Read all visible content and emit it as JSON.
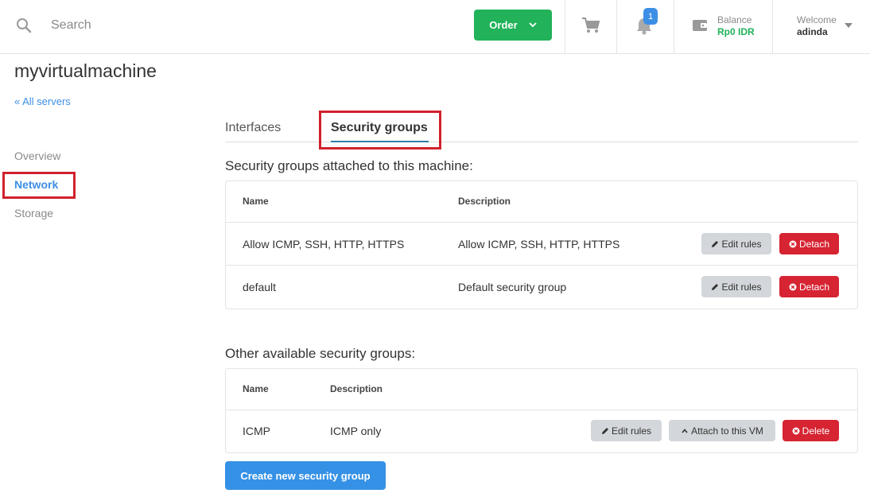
{
  "header": {
    "search_placeholder": "Search",
    "order_label": "Order",
    "notification_count": "1",
    "balance_label": "Balance",
    "balance_value": "Rp0 IDR",
    "welcome_label": "Welcome",
    "user_name": "adinda"
  },
  "page": {
    "title": "myvirtualmachine",
    "back_link": "« All servers"
  },
  "sidebar": {
    "items": [
      {
        "label": "Overview",
        "active": false
      },
      {
        "label": "Network",
        "active": true
      },
      {
        "label": "Storage",
        "active": false
      }
    ]
  },
  "tabs": [
    {
      "label": "Interfaces",
      "active": false
    },
    {
      "label": "Security groups",
      "active": true
    }
  ],
  "attached": {
    "title": "Security groups attached to this machine:",
    "columns": [
      "Name",
      "Description"
    ],
    "rows": [
      {
        "name": "Allow ICMP, SSH, HTTP, HTTPS",
        "description": "Allow ICMP, SSH, HTTP, HTTPS",
        "edit_label": "Edit rules",
        "detach_label": "Detach"
      },
      {
        "name": "default",
        "description": "Default security group",
        "edit_label": "Edit rules",
        "detach_label": "Detach"
      }
    ]
  },
  "other": {
    "title": "Other available security groups:",
    "columns": [
      "Name",
      "Description"
    ],
    "rows": [
      {
        "name": "ICMP",
        "description": "ICMP only",
        "edit_label": "Edit rules",
        "attach_label": "Attach to this VM",
        "delete_label": "Delete"
      }
    ]
  },
  "create_button_label": "Create new security group",
  "colors": {
    "accent": "#3d8fe6",
    "success": "#21b25a",
    "danger": "#d62432",
    "highlight": "#d0212c"
  },
  "icons": {
    "search": "search-icon",
    "order_caret": "chevron-down-icon",
    "cart": "cart-icon",
    "bell": "bell-icon",
    "wallet": "wallet-icon",
    "user_caret": "caret-down-icon",
    "edit": "pencil-icon",
    "detach": "x-circle-icon",
    "attach": "chevron-up-icon",
    "delete": "x-circle-icon"
  }
}
